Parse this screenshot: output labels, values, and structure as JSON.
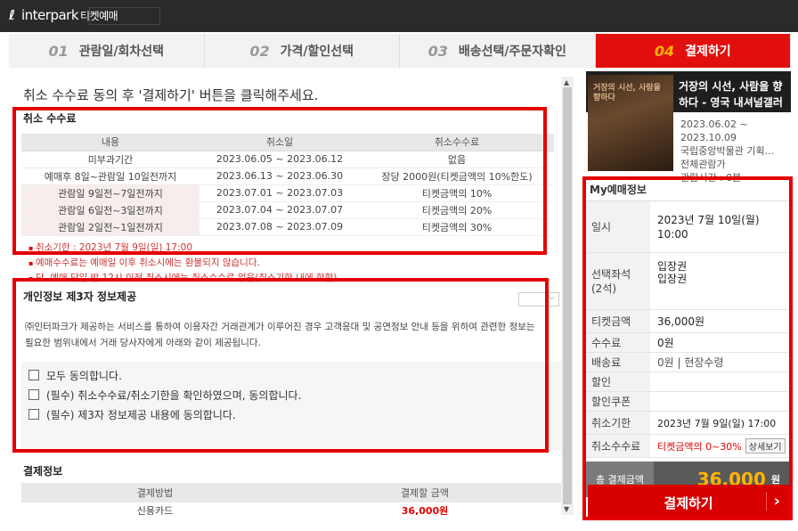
{
  "header": {
    "logo_text": "interpark",
    "logo_sub": "티켓예매"
  },
  "steps": [
    {
      "num": "01",
      "label": "관람일/회차선택"
    },
    {
      "num": "02",
      "label": "가격/할인선택"
    },
    {
      "num": "03",
      "label": "배송선택/주문자확인"
    },
    {
      "num": "04",
      "label": "결제하기"
    }
  ],
  "notice": "취소 수수료 동의 후 '결제하기' 버튼을 클릭해주세요.",
  "fee": {
    "title": "취소 수수료",
    "headers": [
      "내용",
      "취소일",
      "취소수수료"
    ],
    "rows": [
      [
        "미부과기간",
        "2023.06.05 ~ 2023.06.12",
        "없음"
      ],
      [
        "예매후 8일~관람일 10일전까지",
        "2023.06.13 ~ 2023.06.30",
        "장당 2000원(티켓금액의 10%한도)"
      ],
      [
        "관람일 9일전~7일전까지",
        "2023.07.01 ~ 2023.07.03",
        "티켓금액의 10%"
      ],
      [
        "관람일 6일전~3일전까지",
        "2023.07.04 ~ 2023.07.07",
        "티켓금액의 20%"
      ],
      [
        "관람일 2일전~1일전까지",
        "2023.07.08 ~ 2023.07.09",
        "티켓금액의 30%"
      ]
    ],
    "bullets": [
      "취소기한 : 2023년 7월 9일(일) 17:00",
      "예매수수료는 예매일 이후 취소시에는 환불되지 않습니다.",
      "단, 예매 당일 밤 12시 이전 취소시에는 취소수수료 없음(취소기한 내에 한함)"
    ]
  },
  "privacy": {
    "title": "개인정보 제3자 정보제공",
    "desc": "㈜인터파크가 제공하는 서비스를 통하여 이용자간 거래관계가 이루어진 경우 고객응대 및 공연정보 안내 등을 위하여 관련한 정보는 필요한 범위내에서 거래 당사자에게 아래와 같이 제공됩니다.",
    "checks": [
      "모두 동의합니다.",
      "(필수) 취소수수료/취소기한을 확인하였으며, 동의합니다.",
      "(필수) 제3자 정보제공 내용에 동의합니다."
    ]
  },
  "payment": {
    "title": "결제정보",
    "headers": [
      "결제방법",
      "결제할 금액"
    ],
    "row": [
      "신용카드",
      "36,000원"
    ]
  },
  "show": {
    "title": "거장의 시선, 사람을 향하다 - 영국 내셔널갤러",
    "poster_text": "거장의 시선, 사람을 향하다",
    "period": "2023.06.02 ~ 2023.10.09",
    "venue": "국립중앙박물관 기획...",
    "age": "전체관람가",
    "runtime": "관람시간 : 0분"
  },
  "my": {
    "title": "My예매정보",
    "date_label": "일시",
    "date_value": "2023년 7월 10일(월) 10:00",
    "seat_label": "선택좌석\n(2석)",
    "seat_value": "입장권\n입장권",
    "ticket_label": "티켓금액",
    "ticket_value": "36,000원",
    "fee_label": "수수료",
    "fee_value": "0원",
    "delivery_label": "배송료",
    "delivery_value": "0원 | 현장수령",
    "discount_label": "할인",
    "coupon_label": "할인쿠폰",
    "deadline_label": "취소기한",
    "deadline_value": "2023년 7월 9일(일) 17:00",
    "cancelfee_label": "취소수수료",
    "cancelfee_value": "티켓금액의 0~30%",
    "detail_btn": "상세보기",
    "total_label": "총 결제금액",
    "total_value": "36,000",
    "total_unit": "원"
  },
  "pay_button": "결제하기"
}
